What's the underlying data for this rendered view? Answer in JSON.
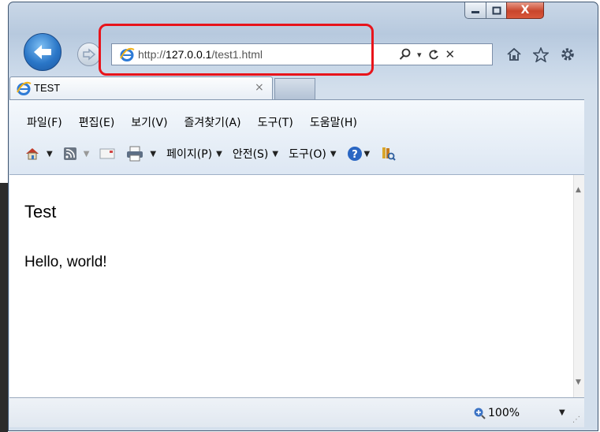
{
  "window": {
    "minimize_label": "–",
    "maximize_label": "□",
    "close_label": "X"
  },
  "address_bar": {
    "url_prefix": "http://",
    "url_host": "127.0.0.1",
    "url_path": "/test1.html",
    "search_icon": "search-icon",
    "dropdown": "▾",
    "refresh_icon": "refresh-icon",
    "stop_label": "✕"
  },
  "toolbar_icons": [
    "home-icon",
    "favorites-star-icon",
    "settings-gear-icon"
  ],
  "tab": {
    "title": "TEST",
    "close_label": "×"
  },
  "menu_bar": {
    "items": [
      "파일(F)",
      "편집(E)",
      "보기(V)",
      "즐겨찾기(A)",
      "도구(T)",
      "도움말(H)"
    ]
  },
  "command_bar": {
    "page_label": "페이지(P)",
    "safety_label": "안전(S)",
    "tools_label": "도구(O)",
    "dropdown": "▼"
  },
  "content": {
    "heading": "Test",
    "text": "Hello, world!"
  },
  "status_bar": {
    "zoom": "100%",
    "dropdown": "▼"
  },
  "colors": {
    "highlight": "#e8141b",
    "close_button": "#c9452c",
    "back_button": "#2a76c7"
  }
}
